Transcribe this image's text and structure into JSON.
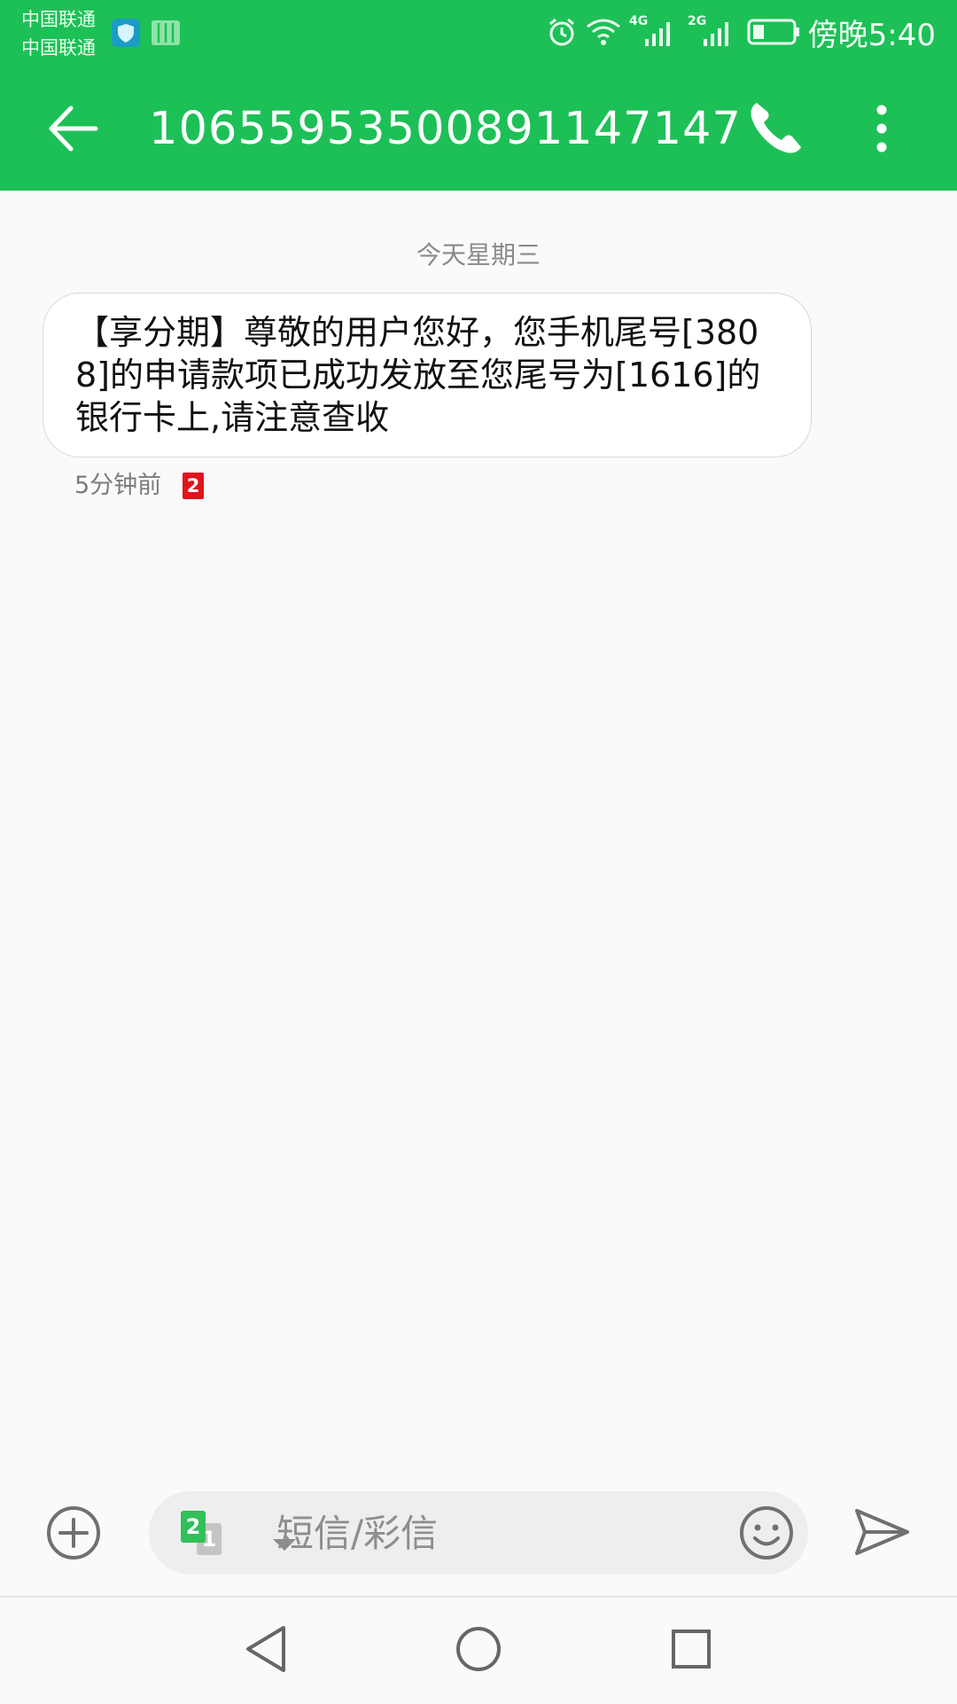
{
  "status_bar": {
    "carrier_1": "中国联通",
    "carrier_2": "中国联通",
    "network_1": "4G",
    "network_2": "2G",
    "time": "傍晚5:40",
    "icons": [
      "shield-app-icon",
      "reader-app-icon",
      "alarm-icon",
      "wifi-icon",
      "signal-4g-icon",
      "signal-2g-icon",
      "battery-icon"
    ]
  },
  "app_bar": {
    "title": "10655953500891147147",
    "icons": [
      "back-arrow-icon",
      "phone-icon",
      "more-vert-icon"
    ]
  },
  "conversation": {
    "date_header": "今天星期三",
    "messages": [
      {
        "text": "【享分期】尊敬的用户您好，您手机尾号[3808]的申请款项已成功发放至您尾号为[1616]的银行卡上,请注意查收",
        "time": "5分钟前",
        "sim": "2"
      }
    ]
  },
  "composer": {
    "placeholder": "短信/彩信",
    "value": "",
    "sim_primary": "2",
    "sim_secondary": "1",
    "icons": [
      "add-circle-icon",
      "sim-select-icon",
      "emoji-icon",
      "send-icon"
    ]
  },
  "nav_bar": {
    "icons": [
      "nav-back-icon",
      "nav-home-icon",
      "nav-recents-icon"
    ]
  },
  "colors": {
    "accent": "#1dc056",
    "sim_badge": "#e0141e",
    "background": "#fafafa"
  }
}
